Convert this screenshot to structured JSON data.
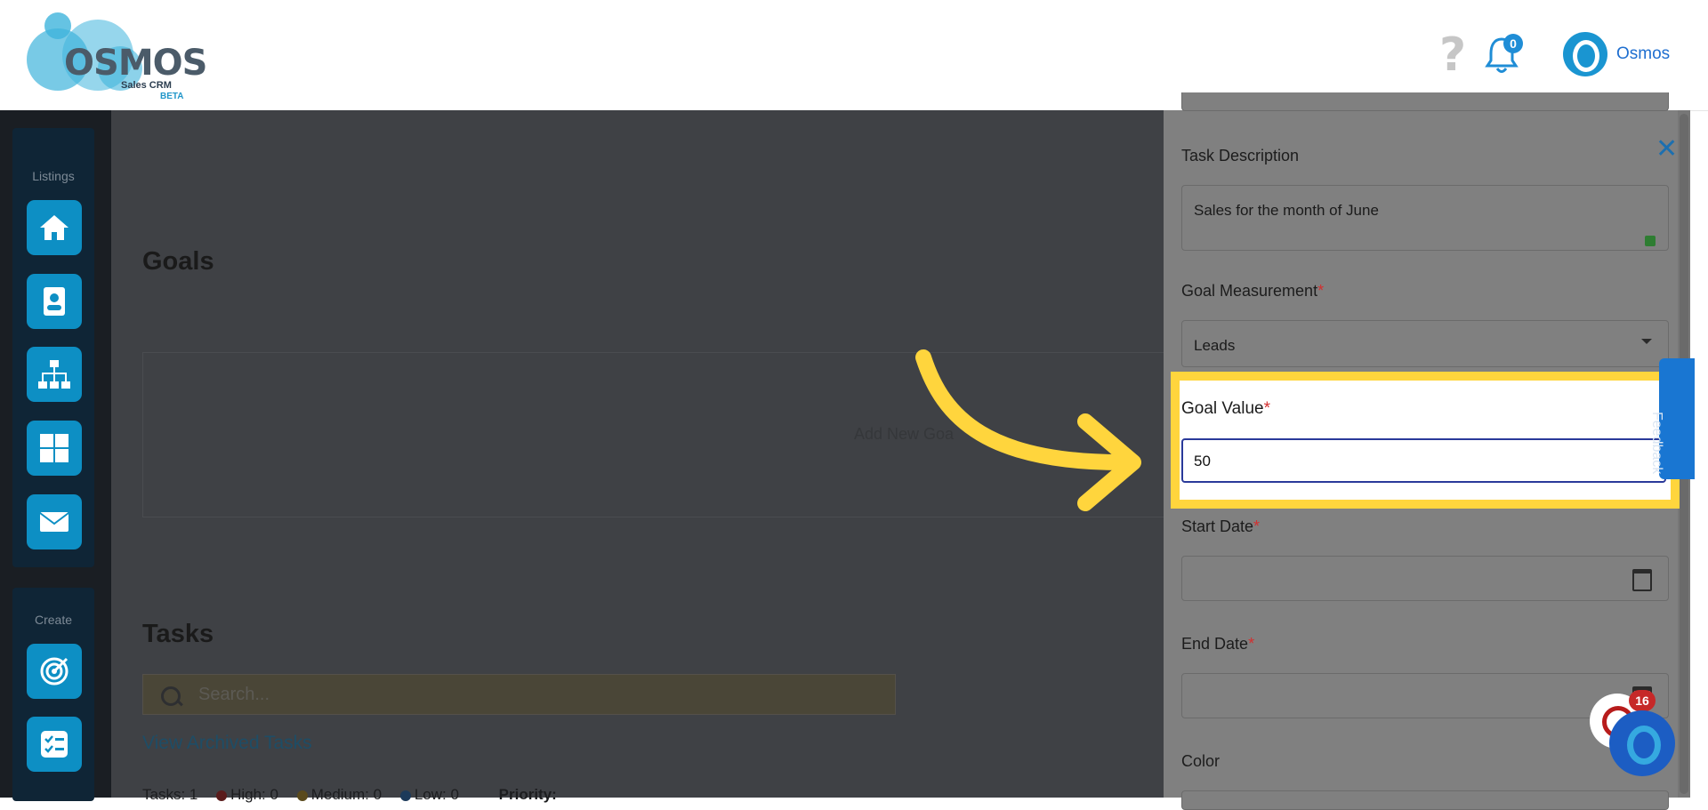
{
  "header": {
    "logo_text": "OSMOS",
    "logo_subtitle": "Sales CRM",
    "logo_badge": "BETA",
    "help_icon": "question-mark-icon",
    "notification_count": "0",
    "user_name": "Osmos"
  },
  "sidebar": {
    "listings_label": "Listings",
    "listings_items": [
      "home-icon",
      "contact-card-icon",
      "org-chart-icon",
      "grid-icon",
      "mail-icon"
    ],
    "create_label": "Create",
    "create_items": [
      "target-icon",
      "checklist-icon"
    ]
  },
  "main": {
    "goals_title": "Goals",
    "goals_add_text": "Add New Goa",
    "tasks_title": "Tasks",
    "search_placeholder": "Search...",
    "view_archived": "View Archived Tasks",
    "tasks_stats": {
      "tasks": "Tasks: 1",
      "high": "High: 0",
      "medium": "Medium: 0",
      "low": "Low: 0",
      "priority": "Priority:"
    }
  },
  "panel": {
    "task_description_label": "Task Description",
    "task_description_value": "Sales for the month of June",
    "goal_measurement_label": "Goal Measurement",
    "goal_measurement_value": "Leads",
    "goal_value_label": "Goal Value",
    "goal_value_value": "50",
    "start_date_label": "Start Date",
    "end_date_label": "End Date",
    "color_label": "Color",
    "required_mark": "*",
    "feedback_label": "Feedback"
  },
  "chat": {
    "badge_count": "16"
  },
  "colors": {
    "accent": "#0d8fc4",
    "highlight": "#ffd53d",
    "required": "#d32f2f"
  }
}
